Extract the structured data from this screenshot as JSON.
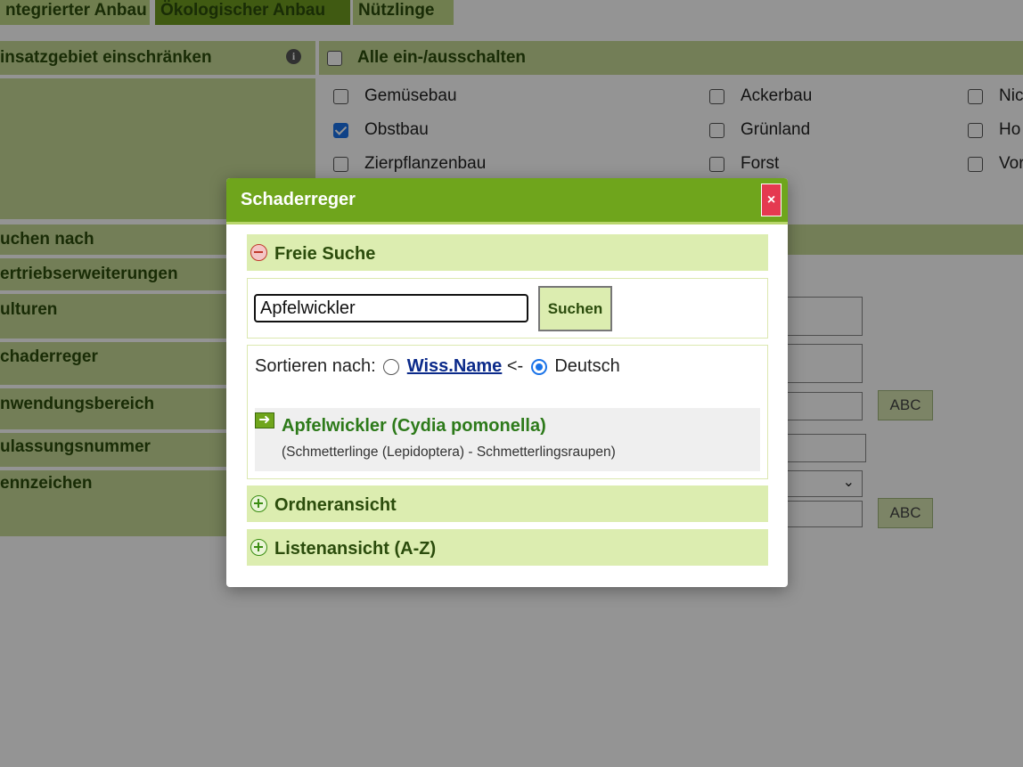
{
  "tabs": [
    {
      "label": "ntegrierter Anbau"
    },
    {
      "label": "Ökologischer Anbau"
    },
    {
      "label": "Nützlinge"
    }
  ],
  "filter": {
    "einsatzgebiet_label": "insatzgebiet einschränken",
    "toggle_all_label": "Alle ein-/ausschalten",
    "options": [
      {
        "label": "Gemüsebau",
        "checked": false
      },
      {
        "label": "Obstbau",
        "checked": true
      },
      {
        "label": "Zierpflanzenbau",
        "checked": false
      },
      {
        "label": "Ackerbau",
        "checked": false
      },
      {
        "label": "Grünland",
        "checked": false
      },
      {
        "label": "Forst",
        "checked": false
      },
      {
        "label": "Nic",
        "checked": false
      },
      {
        "label": "Ho",
        "checked": false
      },
      {
        "label": "Vor",
        "checked": false
      }
    ]
  },
  "form_labels": {
    "suchen_nach": "uchen nach",
    "vertrieb": "ertriebserweiterungen",
    "kulturen": "ulturen",
    "schaderreger": "chaderreger",
    "anwendungsbereich": "nwendungsbereich",
    "zulassungsnummer": "ulassungsnummer",
    "kennzeichen": "ennzeichen"
  },
  "abc_button_label": "ABC",
  "modal": {
    "title": "Schaderreger",
    "close_label": "×",
    "free_search": {
      "label": "Freie Suche",
      "input_value": "Apfelwickler",
      "button_label": "Suchen"
    },
    "sort": {
      "prefix": "Sortieren nach:",
      "option_wiss": "Wiss.Name",
      "arrow": "<-",
      "option_deutsch": "Deutsch",
      "selected": "Deutsch"
    },
    "result": {
      "title": "Apfelwickler (Cydia pomonella)",
      "subtitle": "(Schmetterlinge (Lepidoptera) - Schmetterlingsraupen)"
    },
    "ordneransicht_label": "Ordneransicht",
    "listenansicht_label": "Listenansicht (A-Z)"
  }
}
